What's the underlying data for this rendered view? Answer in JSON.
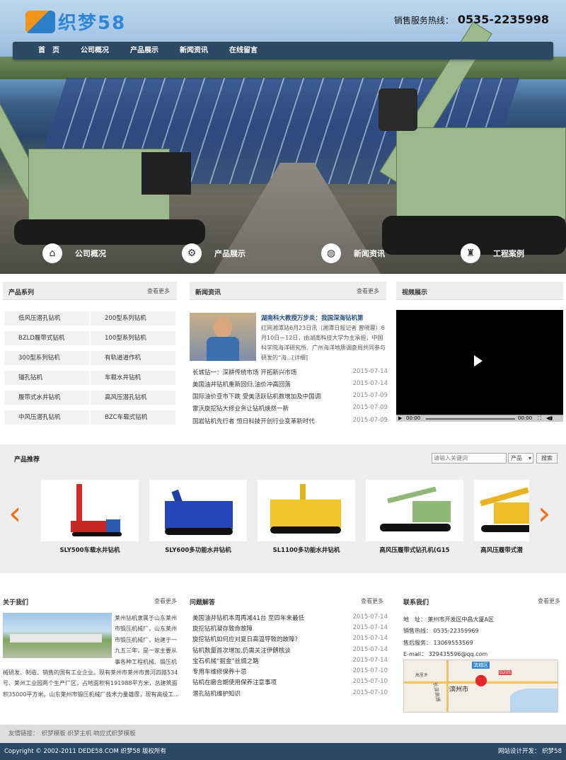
{
  "header": {
    "logo_text": "织梦58",
    "hotline_label": "销售服务热线：",
    "hotline_number": "0535-2235998"
  },
  "nav": [
    "首　页",
    "公司概况",
    "产品展示",
    "新闻资讯",
    "在线留言"
  ],
  "quick_links": [
    {
      "icon": "home-icon",
      "glyph": "⌂",
      "label": "公司概况"
    },
    {
      "icon": "gear-icon",
      "glyph": "⚙",
      "label": "产品展示"
    },
    {
      "icon": "globe-icon",
      "glyph": "◍",
      "label": "新闻资讯"
    },
    {
      "icon": "trophy-icon",
      "glyph": "♜",
      "label": "工程案例"
    }
  ],
  "products": {
    "title": "产品系列",
    "more": "查看更多",
    "items": [
      "低风压潜孔钻机",
      "200型系列钻机",
      "BZLD履带式钻机",
      "100型系列钻机",
      "300型系列钻机",
      "有轨道道作机",
      "锚孔钻机",
      "车载水井钻机",
      "履带式水井钻机",
      "高风压潜孔钻机",
      "中风压潜孔钻机",
      "BZC车载式钻机"
    ]
  },
  "news": {
    "title": "新闻资讯",
    "more": "查看更多",
    "featured_title": "湖南科大教授万步炎：我国深海钻机第",
    "featured_text": "红网湘潭站6月23日讯（湘潭日报记者 曾晓蓉）6月10日—12日，由湖南科技大学为主承担，中国科学院海洋研究所、广州海洋地质调查局共同参与研发的“海...[详细]",
    "items": [
      {
        "title": "长城钻一：深耕传统市场 开拓新兴市场",
        "date": "2015-07-14"
      },
      {
        "title": "美国油井钻机重新回归,油价冲高回落",
        "date": "2015-07-14"
      },
      {
        "title": "国际油价亚市下跌 受美活跃钻机数增加及中国调",
        "date": "2015-07-09"
      },
      {
        "title": "雷沃旋挖钻大修业务让钻机焕然一新",
        "date": "2015-07-09"
      },
      {
        "title": "国岩钻机先行者 恒日科技开创行业变革新时代",
        "date": "2015-07-09"
      }
    ]
  },
  "video": {
    "title": "视频展示",
    "time_left": "00:00",
    "time_right": "00:00"
  },
  "recommend": {
    "title": "产品推荐",
    "search_placeholder": "请输入关键词",
    "select_value": "产品",
    "search_button": "搜索",
    "items": [
      "SLY500车载水井钻机",
      "SLY600多功能水井钻机",
      "SL1100多功能水井钻机",
      "高风压履带式钻孔机(G15",
      "高风压履带式潜"
    ]
  },
  "about": {
    "title": "关于我们",
    "more": "查看更多",
    "text": "莱州钻机隶属于山东莱州市锻压机械厂，山东莱州市锻压机械厂，始建于一九五三年，是一家主要从事各种工程机械、锻压机械研发、制造、销售的国有工业企业。现有莱州市莱州市黄河四路534号、莱州工业园两个生产厂区，占地面积有191988平方米，总建筑面积35000平方米。山东莱州市锻压机械厂技术力量雄厚，现有高级工..."
  },
  "faq": {
    "title": "问题解答",
    "more": "查看更多",
    "items": [
      {
        "title": "美国油井钻机本周再减41台 至四年来最低",
        "date": "2015-07-14"
      },
      {
        "title": "旋挖钻机凝存致命故障",
        "date": "2015-07-14"
      },
      {
        "title": "旋挖钻机如何应对夏日高温导致的故障？",
        "date": "2015-07-14"
      },
      {
        "title": "钻机数量首次增加,仍需关注伊朗核谈",
        "date": "2015-07-14"
      },
      {
        "title": "宝石机械“掘金”丝绸之路",
        "date": "2015-07-14"
      },
      {
        "title": "专用车维修保养十忌",
        "date": "2015-07-10"
      },
      {
        "title": "钻机在磨合期使用保养注意事项",
        "date": "2015-07-10"
      },
      {
        "title": "潜孔钻机维护知识",
        "date": "2015-07-10"
      }
    ]
  },
  "contact": {
    "title": "联系我们",
    "more": "查看更多",
    "lines": [
      "地　址：  莱州市开发区中昌大厦A区",
      "销售热线：  0535-22359969",
      "售后服务：  13069553569",
      "E-mail：  329435596@qq.com"
    ],
    "map_labels": [
      "滨城区",
      "G205",
      "高里乡",
      "长深高速",
      "滨州市"
    ]
  },
  "friends": "友情链接：　织梦模板  织梦主机  响应式织梦模板",
  "footer": {
    "copyright": "Copyright © 2002-2011 DEDE58.COM 织梦58 版权所有",
    "dev": "网站设计开发：  织梦58"
  },
  "colors": {
    "nav": "#2b4864",
    "accent": "#f36f16",
    "link": "#2f86d8"
  }
}
